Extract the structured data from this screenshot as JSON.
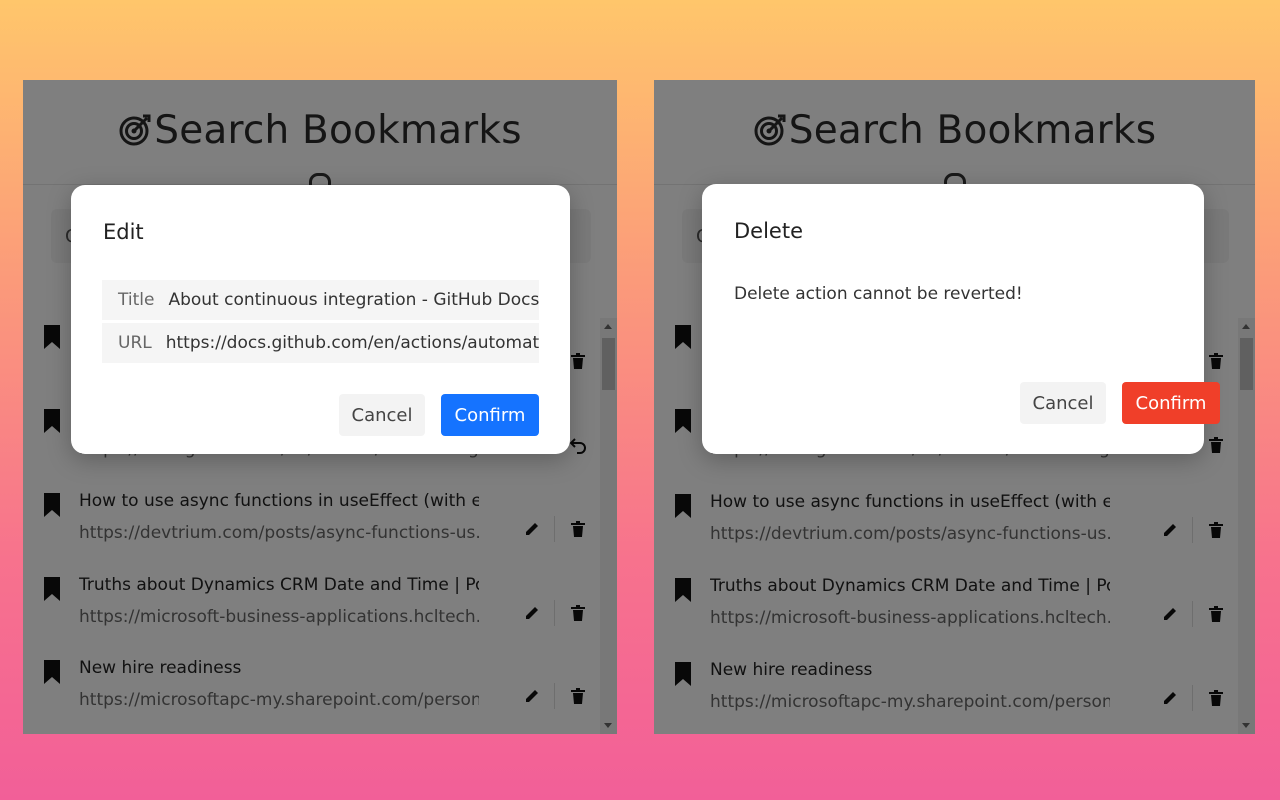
{
  "app": {
    "title": "Search Bookmarks",
    "icon": "target-icon",
    "search_placeholder": "Q"
  },
  "bookmarks": [
    {
      "title": "",
      "url": ""
    },
    {
      "title": "",
      "url": "https://docs.github.com/en/actions/automating..."
    },
    {
      "title": "How to use async functions in useEffect (with ex...",
      "url": "https://devtrium.com/posts/async-functions-us..."
    },
    {
      "title": "Truths about Dynamics CRM Date and Time | Po...",
      "url": "https://microsoft-business-applications.hcltech...."
    },
    {
      "title": "New hire readiness",
      "url": "https://microsoftapc-my.sharepoint.com/person..."
    }
  ],
  "edit_dialog": {
    "title": "Edit",
    "title_label": "Title",
    "title_value": "About continuous integration - GitHub Docs",
    "url_label": "URL",
    "url_value": "https://docs.github.com/en/actions/automating-builds-and-tests",
    "cancel_label": "Cancel",
    "confirm_label": "Confirm",
    "confirm_color": "#1573ff"
  },
  "delete_dialog": {
    "title": "Delete",
    "message": "Delete action cannot be reverted!",
    "cancel_label": "Cancel",
    "confirm_label": "Confirm",
    "confirm_color": "#f03f29"
  }
}
